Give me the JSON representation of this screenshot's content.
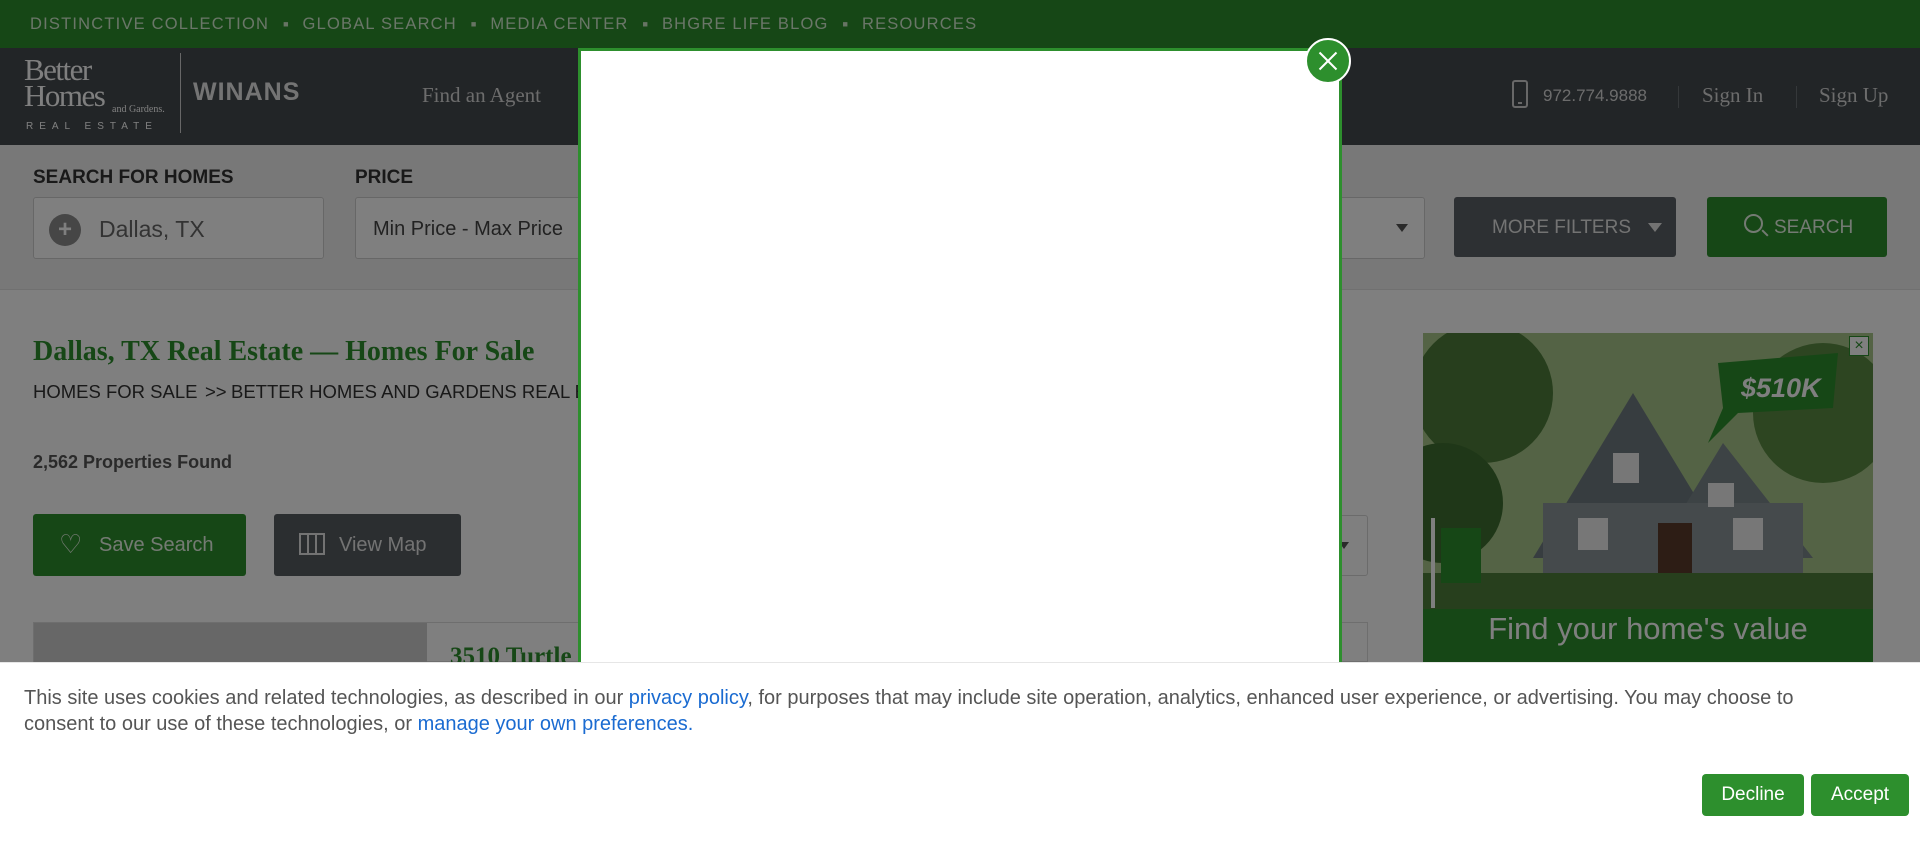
{
  "topnav": {
    "items": [
      "DISTINCTIVE COLLECTION",
      "GLOBAL SEARCH",
      "MEDIA CENTER",
      "BHGRE LIFE BLOG",
      "RESOURCES"
    ]
  },
  "header": {
    "logo_line1": "Better",
    "logo_line2": "Homes",
    "logo_line3": "and Gardens.",
    "logo_line4": "REAL ESTATE",
    "brand": "WINANS",
    "nav_find_agent": "Find an Agent",
    "phone": "972.774.9888",
    "sign_in": "Sign In",
    "sign_up": "Sign Up"
  },
  "search": {
    "location_label": "SEARCH FOR HOMES",
    "location_value": "Dallas, TX",
    "price_label": "PRICE",
    "price_value": "Min Price  -  Max Price",
    "more_filters": "MORE FILTERS",
    "search_button": "SEARCH"
  },
  "results": {
    "title": "Dallas, TX Real Estate — Homes For Sale",
    "breadcrumb": [
      "HOMES FOR SALE",
      "BETTER HOMES AND GARDENS REAL ESTATE"
    ],
    "breadcrumb_sep": ">>",
    "count": "2,562 Properties Found",
    "save_search": "Save Search",
    "view_map": "View Map",
    "first_listing_title": "3510 Turtle"
  },
  "ad": {
    "price_tag": "$510K",
    "cta": "Find your home's value"
  },
  "cookie": {
    "text_part1": "This site uses cookies and related technologies, as described in our ",
    "privacy_link": "privacy policy",
    "text_part2": ", for purposes that may include site operation, analytics, enhanced user experience, or advertising. You may choose to",
    "text_part3": "consent to our use of these technologies, or ",
    "manage_link": "manage your own preferences",
    "text_part4": ".",
    "decline": "Decline",
    "accept": "Accept"
  },
  "colors": {
    "brand_green": "#2d8f2d",
    "header_dark": "#444a4e",
    "link_blue": "#1a6bd1"
  }
}
